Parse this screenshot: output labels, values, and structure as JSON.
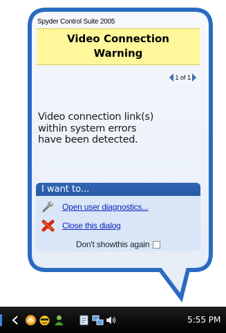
{
  "notification": {
    "app_name": "Spyder Control Suite 2005",
    "title_line1": "Video Connection",
    "title_line2": "Warning",
    "pager": "1 of 1",
    "message_line1": "Video connection link(s)",
    "message_line2": "within system errors",
    "message_line3": "have been detected.",
    "actions_header": "I want to...",
    "action_diagnostics": "Open user diagnostics...",
    "action_close": "Close this dialog",
    "dont_show_label": "Don't showthis again",
    "dont_show_checked": false
  },
  "taskbar": {
    "clock": "5:55 PM",
    "icons": [
      "show-hidden-chevron-icon",
      "update-alert-icon",
      "messenger-smiley-icon",
      "user-person-icon",
      "notepad-icon",
      "network-icon",
      "speaker-icon"
    ]
  },
  "colors": {
    "balloon_border": "#2a6bc0",
    "title_band": "#fff79a",
    "actions_header": "#2f63b0",
    "actions_body": "#d8e6f8",
    "link": "#0b24b6"
  }
}
